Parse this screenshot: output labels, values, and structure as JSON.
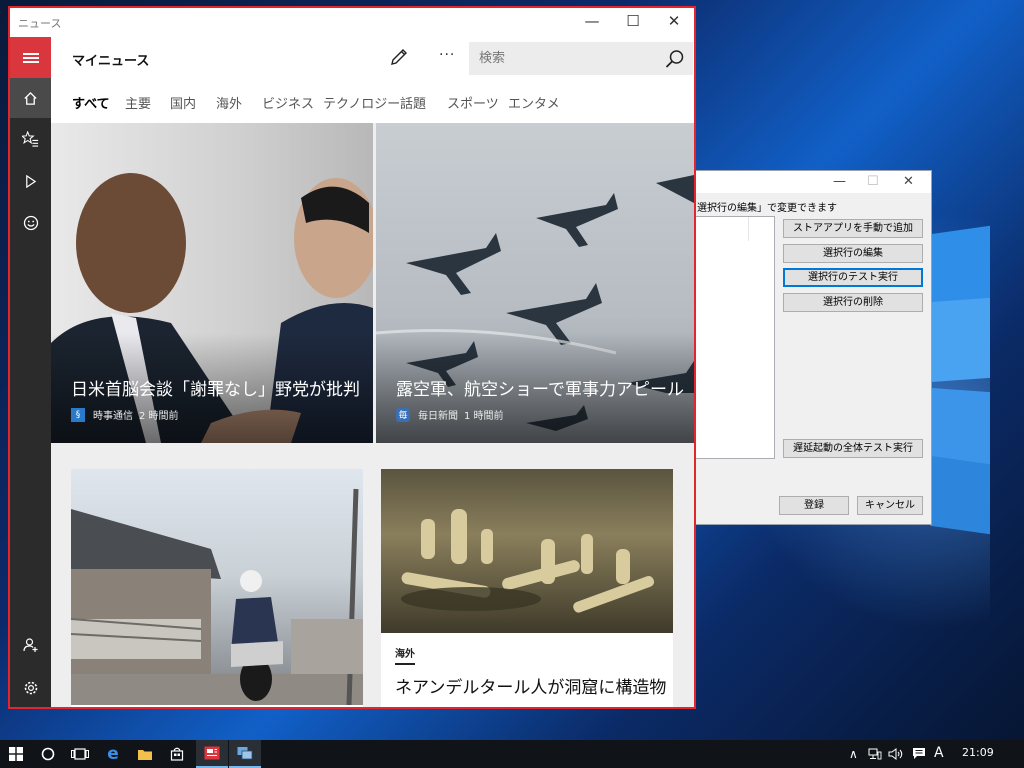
{
  "news": {
    "window_title": "ニュース",
    "page_title": "マイニュース",
    "search_placeholder": "検索",
    "more_label": "···",
    "tabs": [
      {
        "label": "すべて",
        "active": true
      },
      {
        "label": "主要"
      },
      {
        "label": "国内"
      },
      {
        "label": "海外"
      },
      {
        "label": "ビジネス"
      },
      {
        "label": "テクノロジー"
      },
      {
        "label": "話題"
      },
      {
        "label": "スポーツ"
      },
      {
        "label": "エンタメ"
      }
    ],
    "hero_articles": [
      {
        "headline": "日米首脳会談「謝罪なし」野党が批判",
        "source": "時事通信",
        "time": "2 時間前",
        "logo": "jiji-logo-icon"
      },
      {
        "headline": "露空軍、航空ショーで軍事力アピール",
        "source": "毎日新聞",
        "time": "1 時間前",
        "logo": "mainichi-logo-icon",
        "logo_text": "毎"
      }
    ],
    "cards": [
      {
        "category": "",
        "title": ""
      },
      {
        "category": "海外",
        "title": "ネアンデルタール人が洞窟に構造物"
      }
    ],
    "accent_color": "#d9363e",
    "frame_color": "#e3262b"
  },
  "dialog": {
    "description": "選択行の編集」で変更できます",
    "buttons": {
      "add_store_app": "ストアアプリを手動で追加",
      "edit_row": "選択行の編集",
      "test_row": "選択行のテスト実行",
      "delete_row": "選択行の削除",
      "test_all_delayed": "遅延起動の全体テスト実行",
      "register": "登録",
      "cancel": "キャンセル"
    }
  },
  "taskbar": {
    "clock": "21:09",
    "ime": "A"
  }
}
